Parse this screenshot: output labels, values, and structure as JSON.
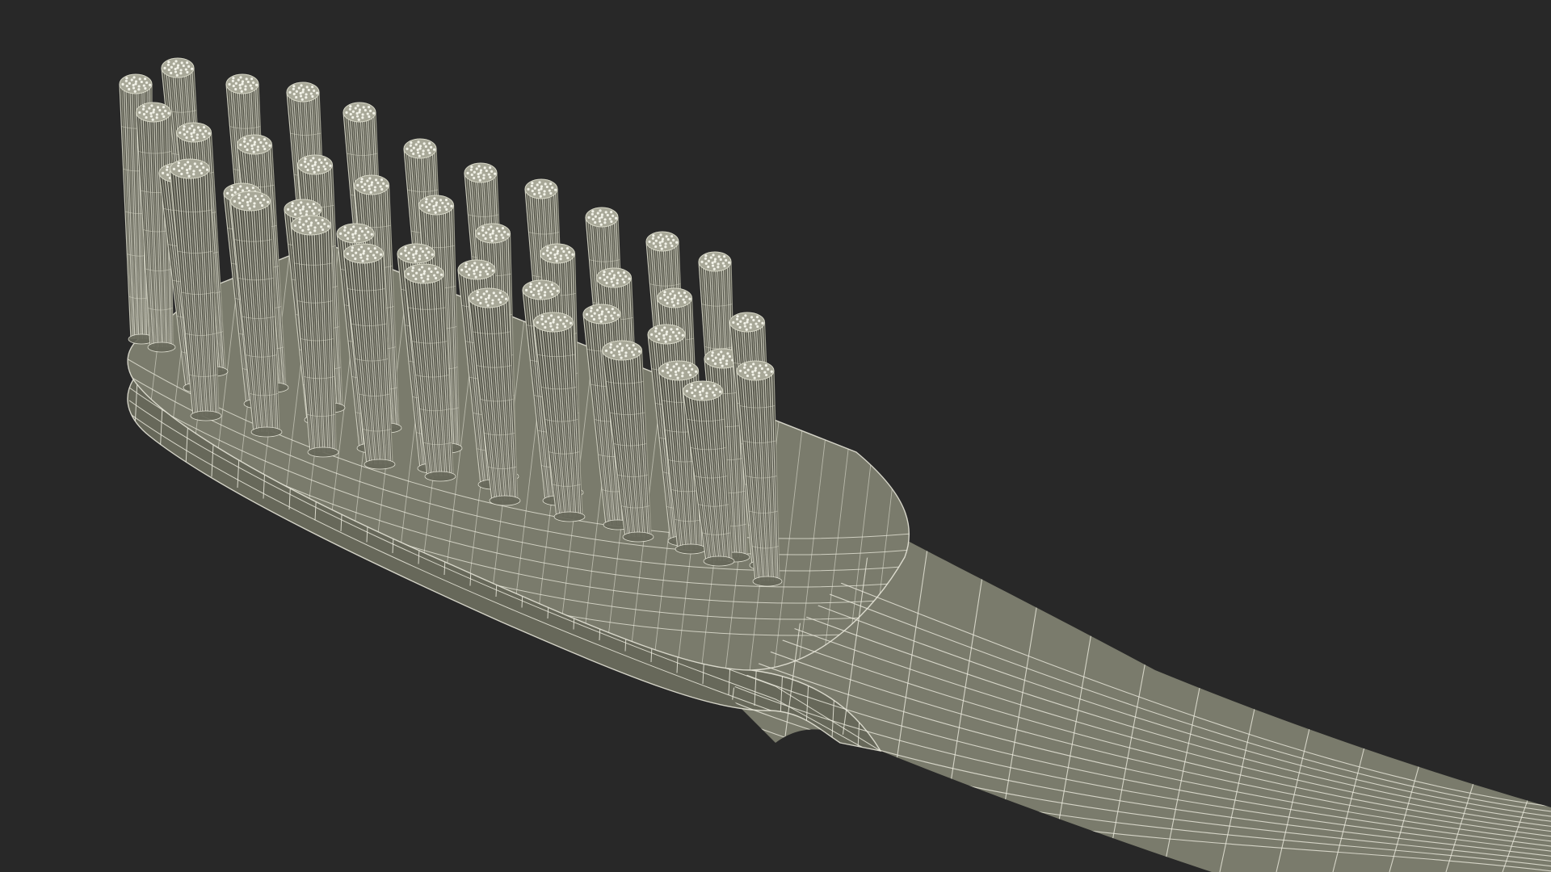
{
  "scene": {
    "subject": "toothbrush-head-wireframe",
    "render_style": "wireframe-over-shaded",
    "tuft_count": 40
  },
  "colors": {
    "background": "#282828",
    "surface": "#7a7b6c",
    "surface_dark": "#67685a",
    "surface_light": "#8a8b7c",
    "wire": "#ecebde",
    "bristle_light": "#d8d8c8",
    "bristle_mid": "#a8a898",
    "bristle_dark": "#4e4e44",
    "bristle_tip": "#f2f2e8"
  }
}
